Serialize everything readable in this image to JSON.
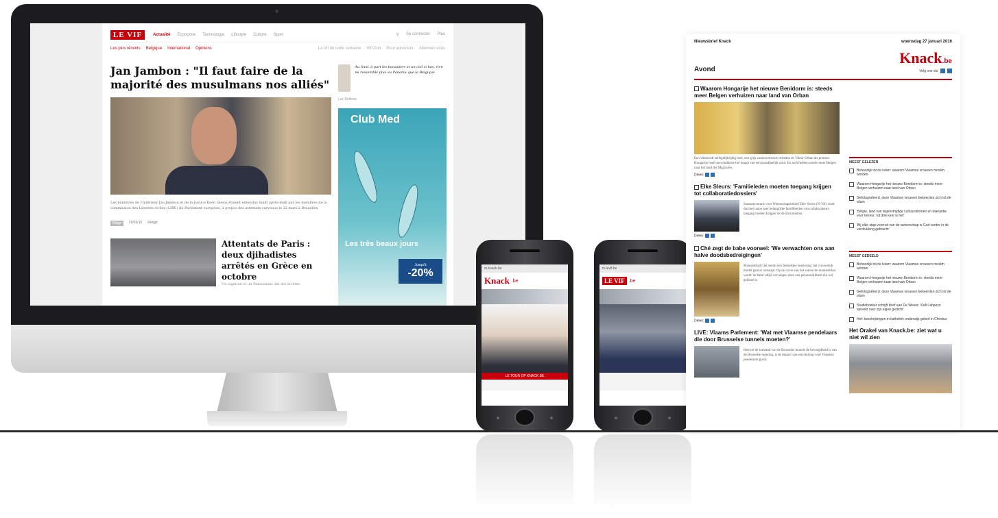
{
  "desktop": {
    "logo": "LE VIF",
    "nav": [
      "Actualité",
      "Economie",
      "Technologie",
      "Lifestyle",
      "Culture",
      "Sport"
    ],
    "search_label": "Se connecter",
    "plus_label": "Plus",
    "subnav": [
      "Les plus récents",
      "Belgique",
      "International",
      "Opinions"
    ],
    "subnav_right": [
      "Le Vif de cette semaine",
      "Vif Club",
      "Pour annoncer",
      "Abonnez-vous"
    ],
    "headline": "Jan Jambon : \"Il faut faire de la majorité des musulmans nos alliés\"",
    "caption": "Les ministres de l'Intérieur Jan Jambon et de la Justice Koen Geens étaient entendus lundi après-midi par les membres de la commission des Libertés civiles (LIBE) du Parlement européen, à propos des attentats survenus le 22 mars à Bruxelles.",
    "meta_tag": "Belga",
    "meta_views": "29/03/16",
    "meta_comments": "Réagir",
    "second_title": "Attentats de Paris : deux djihadistes arrêtés en Grèce en octobre",
    "second_teaser": "Un algérien et un Pakistanais ont été arrêtés",
    "quote": "Au fond, à part les banquiers et un ciel si bas, rien ne ressemble plus au Panama que la Belgique",
    "quote_author": "Luc Dellisse",
    "ad_brand": "Club Med",
    "ad_promo": "Les très beaux jours",
    "ad_discount_prefix": "Jusqu'à",
    "ad_discount": "-20%"
  },
  "phone1": {
    "url": "m.knack.be",
    "logo": "Knack",
    "logo_suffix": ".be",
    "bar": "LE TOUR OP KNACK.BE"
  },
  "phone2": {
    "url": "m.levif.be",
    "logo": "LE VIF",
    "logo_suffix": ".be"
  },
  "newsletter": {
    "label": "Nieuwsbrief Knack",
    "date": "woensdag 27 januari 2016",
    "edition": "Avond",
    "logo": "Knack",
    "logo_suffix": ".be",
    "follow": "Volg ons via",
    "articles": [
      {
        "title": "Waarom Hongarije het nieuwe Benidorm is: steeds meer Belgen verhuizen naar land van Orban",
        "text": "Een viktoriedt zelfsgelijktijdig heel, een grijs zonnuweertsch verleden en Viktor Orban als premier. Hongarije heeft met mekkens het imago van een paradijselijk oord. En toch hebben steeds meer Belgen naar het land der Magyaren.",
        "share": "Delen:"
      },
      {
        "title": "Elke Sleurs: 'Familieleden moeten toegang krijgen tot collaboratiedossiers'",
        "text": "Staatssecretaris voor Wetenschapsbeleid Elke Sleurs (N-VA) vindt dat met name zeer belangrijke familieleden van collaborateurs toegang moeten krijgen tot de documenten.",
        "share": "Delen:"
      },
      {
        "title": "Ché zegt de babe voorwel: 'We verwachten ons aan halve doodsbedreigingen'",
        "text": "Mannenblad Ché neemt een feestelijke beslissing: het vrouwelijk model gaat er ontsnapt. Op de cover van het satirische mannenblad wordt 'de babe' altijd vervangen door een persoonlijkheid die wel gekleed is.",
        "share": "Delen:"
      },
      {
        "title": "LIVE: Vlaams Parlement: 'Wat met Vlaamse pendelaars die door Brusselse tunnels moeten?'",
        "text": "Hoewel de toestand van de Brusselse tunnels de bevoegdheid is van de Brusselse regering, is de impact van een sluiting voor Vlaamse pendelaars groot."
      }
    ],
    "most_read_heading": "MEEST GELEZEN",
    "most_read": [
      "Behoorlijk tot de islam: waarom Vlaamse vrouwen moslim worden",
      "Waarom Hongarije het nieuwe Benidorm is: steeds meer Belgen verhuizen naar land van Orban",
      "Gefotografeerd, deze Vlaamse vrouwen bekeerden zich tot de islam",
      "'Belgie, land van tegenstrijdige cultuurstromen en tolerantie voor terreur: tot drie keer is het'",
      "'Bij elke stap voorruit van de wetenschap is God verder in de verdrukking gebracht'"
    ],
    "most_shared_heading": "MEEST GEDEELD",
    "most_shared": [
      "Behoorlijk tot de islam: waarom Vlaamse vrouwen moslim worden",
      "Waarom Hongarije het nieuwe Benidorm is: steeds meer Belgen verhuizen naar land van Orban",
      "Gefotografeerd, deze Vlaamse vrouwen bekeerden zich tot de islam",
      "Studieboeker schrijft brief aan De Wever: 'Kufi Lahpeys spreekt over zijn eigen gedicht'",
      "Hof: beschrijvingen in katholiek onderwijs geloof in Christus"
    ],
    "orakel_title": "Het Orakel van Knack.be: ziet wat u niet wil zien"
  }
}
